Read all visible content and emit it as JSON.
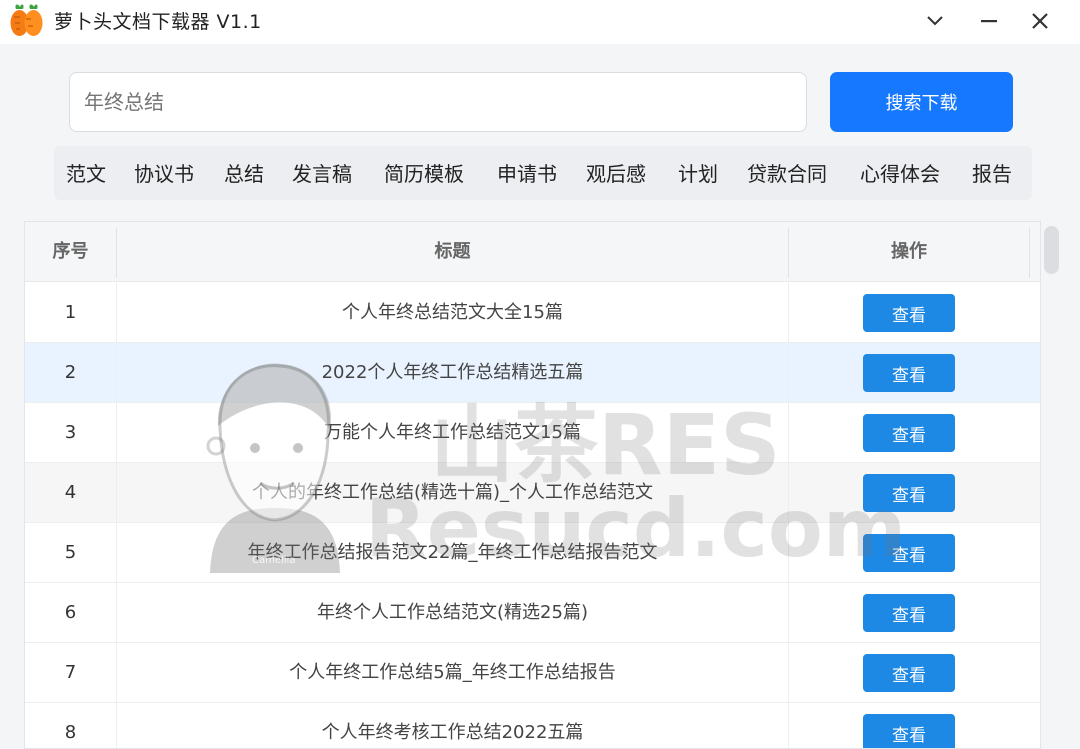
{
  "window": {
    "title": "萝卜头文档下载器  V1.1",
    "controls": [
      "chevron-down-icon",
      "minimize-icon",
      "close-icon"
    ]
  },
  "search": {
    "value": "",
    "placeholder": "年终总结",
    "button_label": "搜索下载"
  },
  "categories": [
    "范文",
    "协议书",
    "总结",
    "发言稿",
    "简历模板",
    "申请书",
    "观后感",
    "计划",
    "贷款合同",
    "心得体会",
    "报告"
  ],
  "table": {
    "columns": [
      "序号",
      "标题",
      "操作"
    ],
    "action_label": "查看",
    "selected_row": 2,
    "rows": [
      {
        "index": "1",
        "title": "个人年终总结范文大全15篇"
      },
      {
        "index": "2",
        "title": "2022个人年终工作总结精选五篇"
      },
      {
        "index": "3",
        "title": "万能个人年终工作总结范文15篇"
      },
      {
        "index": "4",
        "title": "个人的年终工作总结(精选十篇)_个人工作总结范文"
      },
      {
        "index": "5",
        "title": "年终工作总结报告范文22篇_年终工作总结报告范文"
      },
      {
        "index": "6",
        "title": "年终个人工作总结范文(精选25篇)"
      },
      {
        "index": "7",
        "title": "个人年终工作总结5篇_年终工作总结报告"
      },
      {
        "index": "8",
        "title": "个人年终考核工作总结2022五篇"
      }
    ]
  },
  "watermark": {
    "line1": "山茶RES",
    "line2": "Resucd.com",
    "signature": "Camellia"
  },
  "colors": {
    "primary": "#1677ff",
    "view_button": "#1e88e5",
    "selected_row": "#e8f3ff",
    "category_bar": "#eceef1",
    "workspace": "#f4f5f7"
  }
}
